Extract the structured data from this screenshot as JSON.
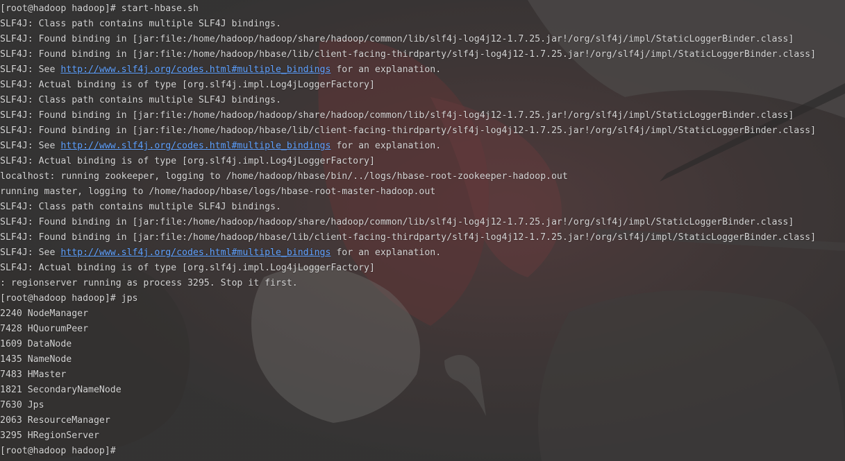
{
  "terminal": {
    "lines": [
      {
        "parts": [
          {
            "text": "[root@hadoop hadoop]# start-hbase.sh"
          }
        ]
      },
      {
        "parts": [
          {
            "text": "SLF4J: Class path contains multiple SLF4J bindings."
          }
        ]
      },
      {
        "parts": [
          {
            "text": "SLF4J: Found binding in [jar:file:/home/hadoop/hadoop/share/hadoop/common/lib/slf4j-log4j12-1.7.25.jar!/org/slf4j/impl/StaticLoggerBinder.class]"
          }
        ]
      },
      {
        "parts": [
          {
            "text": "SLF4J: Found binding in [jar:file:/home/hadoop/hbase/lib/client-facing-thirdparty/slf4j-log4j12-1.7.25.jar!/org/slf4j/impl/StaticLoggerBinder.class]"
          }
        ]
      },
      {
        "parts": [
          {
            "text": "SLF4J: See "
          },
          {
            "text": "http://www.slf4j.org/codes.html#multiple_bindings",
            "link": true
          },
          {
            "text": " for an explanation."
          }
        ]
      },
      {
        "parts": [
          {
            "text": "SLF4J: Actual binding is of type [org.slf4j.impl.Log4jLoggerFactory]"
          }
        ]
      },
      {
        "parts": [
          {
            "text": "SLF4J: Class path contains multiple SLF4J bindings."
          }
        ]
      },
      {
        "parts": [
          {
            "text": "SLF4J: Found binding in [jar:file:/home/hadoop/hadoop/share/hadoop/common/lib/slf4j-log4j12-1.7.25.jar!/org/slf4j/impl/StaticLoggerBinder.class]"
          }
        ]
      },
      {
        "parts": [
          {
            "text": "SLF4J: Found binding in [jar:file:/home/hadoop/hbase/lib/client-facing-thirdparty/slf4j-log4j12-1.7.25.jar!/org/slf4j/impl/StaticLoggerBinder.class]"
          }
        ]
      },
      {
        "parts": [
          {
            "text": "SLF4J: See "
          },
          {
            "text": "http://www.slf4j.org/codes.html#multiple_bindings",
            "link": true
          },
          {
            "text": " for an explanation."
          }
        ]
      },
      {
        "parts": [
          {
            "text": "SLF4J: Actual binding is of type [org.slf4j.impl.Log4jLoggerFactory]"
          }
        ]
      },
      {
        "parts": [
          {
            "text": "localhost: running zookeeper, logging to /home/hadoop/hbase/bin/../logs/hbase-root-zookeeper-hadoop.out"
          }
        ]
      },
      {
        "parts": [
          {
            "text": "running master, logging to /home/hadoop/hbase/logs/hbase-root-master-hadoop.out"
          }
        ]
      },
      {
        "parts": [
          {
            "text": "SLF4J: Class path contains multiple SLF4J bindings."
          }
        ]
      },
      {
        "parts": [
          {
            "text": "SLF4J: Found binding in [jar:file:/home/hadoop/hadoop/share/hadoop/common/lib/slf4j-log4j12-1.7.25.jar!/org/slf4j/impl/StaticLoggerBinder.class]"
          }
        ]
      },
      {
        "parts": [
          {
            "text": "SLF4J: Found binding in [jar:file:/home/hadoop/hbase/lib/client-facing-thirdparty/slf4j-log4j12-1.7.25.jar!/org/slf4j/impl/StaticLoggerBinder.class]"
          }
        ]
      },
      {
        "parts": [
          {
            "text": "SLF4J: See "
          },
          {
            "text": "http://www.slf4j.org/codes.html#multiple_bindings",
            "link": true
          },
          {
            "text": " for an explanation."
          }
        ]
      },
      {
        "parts": [
          {
            "text": "SLF4J: Actual binding is of type [org.slf4j.impl.Log4jLoggerFactory]"
          }
        ]
      },
      {
        "parts": [
          {
            "text": ": regionserver running as process 3295. Stop it first."
          }
        ]
      },
      {
        "parts": [
          {
            "text": "[root@hadoop hadoop]# jps"
          }
        ]
      },
      {
        "parts": [
          {
            "text": "2240 NodeManager"
          }
        ]
      },
      {
        "parts": [
          {
            "text": "7428 HQuorumPeer"
          }
        ]
      },
      {
        "parts": [
          {
            "text": "1609 DataNode"
          }
        ]
      },
      {
        "parts": [
          {
            "text": "1435 NameNode"
          }
        ]
      },
      {
        "parts": [
          {
            "text": "7483 HMaster"
          }
        ]
      },
      {
        "parts": [
          {
            "text": "1821 SecondaryNameNode"
          }
        ]
      },
      {
        "parts": [
          {
            "text": "7630 Jps"
          }
        ]
      },
      {
        "parts": [
          {
            "text": "2063 ResourceManager"
          }
        ]
      },
      {
        "parts": [
          {
            "text": "3295 HRegionServer"
          }
        ]
      },
      {
        "parts": [
          {
            "text": "[root@hadoop hadoop]#"
          }
        ],
        "prompt": true
      }
    ]
  },
  "colors": {
    "text": "#d4d4d4",
    "link": "#5ea1ff",
    "background": "#3b3b3b"
  },
  "icons": {
    "wallpaper": "anime-artwork-background"
  }
}
